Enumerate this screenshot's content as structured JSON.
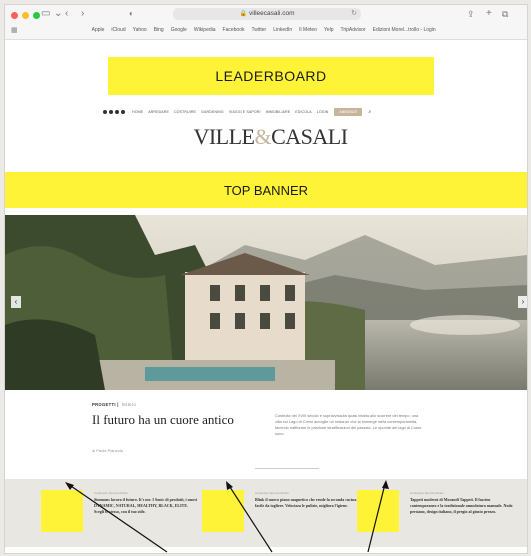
{
  "browser": {
    "address": "villeecasali.com",
    "bookmarks": [
      "Apple",
      "iCloud",
      "Yahoo",
      "Bing",
      "Google",
      "Wikipedia",
      "Facebook",
      "Twitter",
      "LinkedIn",
      "Il Meteo",
      "Yelp",
      "TripAdvisor",
      "Edizioni Morel...trollo - Login"
    ]
  },
  "ads": {
    "leaderboard": "LEADERBOARD",
    "top_banner": "TOP BANNER"
  },
  "nav": {
    "items": [
      "HOME",
      "ARREDARE",
      "COSTRUIRE",
      "GARDENING",
      "VIAGGI E SAPORI",
      "IMMOBILIARE",
      "EDICOLA",
      "LOGIN"
    ],
    "subscribe": "ABBONATI"
  },
  "logo": {
    "left": "VILLE",
    "amp": "&",
    "right": "CASALI"
  },
  "article": {
    "kicker": "PROGETTI",
    "kicker_tag": "Estero",
    "headline": "Il futuro ha un cuore antico",
    "excerpt": "Costruita nel XVIII secolo e sopravvissuta quasi intatta allo scorrere del tempo, una villa sul Lago di Como accoglie un restauro che la immerge nella contemporaneità, facendo riaffiorare le preziose stratificazioni del passato. Le sponde del lago di Como sono.",
    "author": "di Paola Pianzola"
  },
  "sponsored": [
    {
      "label": "Contenuto Sponsorizzato",
      "text": "Simmons lavora il futuro. It's me. I Sonic di prodotti, i nuovi DYNAMIC, NATURAL, HEALTHY, BLACK, ELITE. Scegli te stesso, con il tuo stile."
    },
    {
      "label": "Contenuto Sponsorizzato",
      "text": "Blink il nuovo piano magnetico che rende la seconda cucina facile da togliere. Velocizza le pulizie, migliora l'igiene."
    },
    {
      "label": "Contenuto Sponsorizzato",
      "text": "Tappeti moderni di Morandi Tappeti. Il fascino contemporaneo e la tradizionale annodatura manuale. Nodo persiano, design italiano, il pregio al giusto prezzo."
    }
  ],
  "colors": {
    "ad_yellow": "#fff338",
    "accent": "#c8b49a"
  },
  "icons": [
    "close-dot-icon",
    "minimize-dot-icon",
    "zoom-dot-icon",
    "sidebar-icon",
    "back-icon",
    "forward-icon",
    "privacy-icon",
    "lock-icon",
    "reload-icon",
    "share-icon",
    "new-tab-icon",
    "tabs-icon",
    "search-icon",
    "prev-slide-icon",
    "next-slide-icon"
  ]
}
